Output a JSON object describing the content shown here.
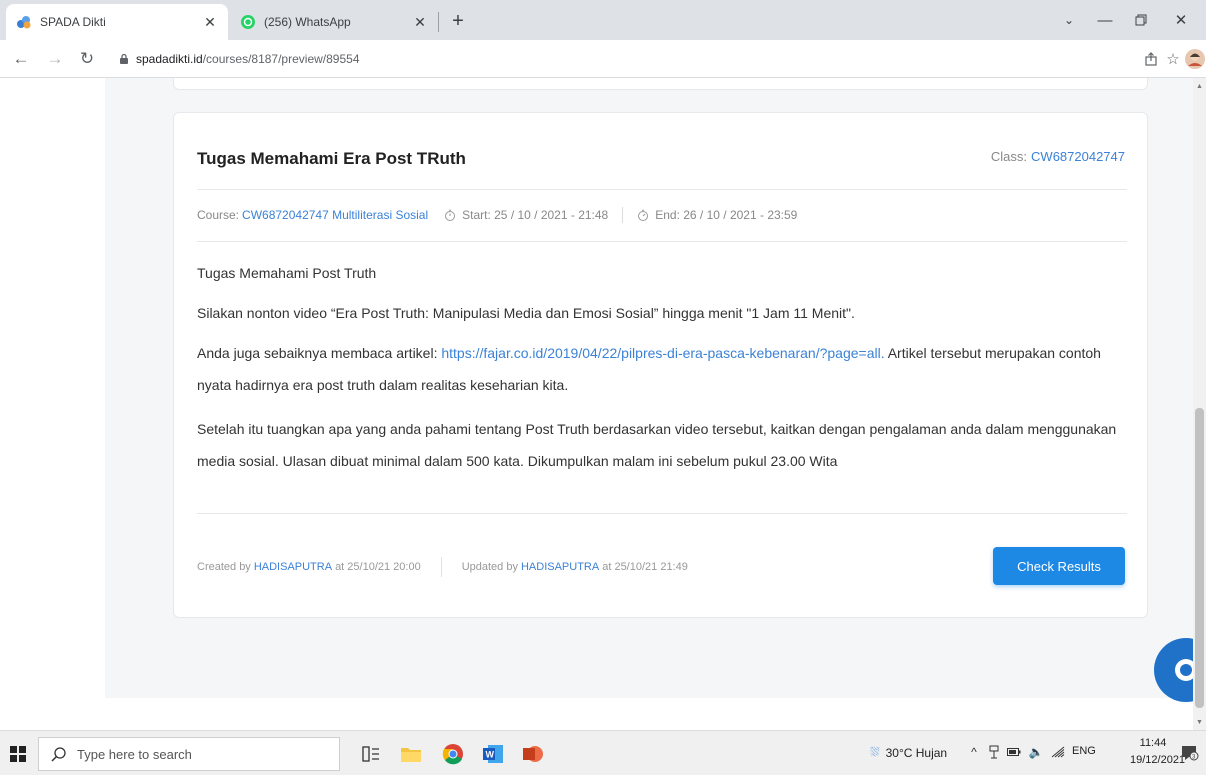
{
  "browser": {
    "tabs": [
      {
        "title": "SPADA Dikti",
        "active": true,
        "icon": "spada-logo-icon"
      },
      {
        "title": "(256) WhatsApp",
        "active": false,
        "icon": "whatsapp-icon"
      }
    ],
    "url_domain": "spadadikti.id",
    "url_path": "/courses/8187/preview/89554"
  },
  "card": {
    "title": "Tugas Memahami Era Post TRuth",
    "class_label": "Class:",
    "class_code": "CW6872042747",
    "course_label": "Course:",
    "course_name": "CW6872042747 Multiliterasi Sosial",
    "start": "Start: 25 / 10 / 2021 - 21:48",
    "end": "End: 26 / 10 / 2021 - 23:59",
    "paragraphs": {
      "p1": "Tugas Memahami Post Truth",
      "p2": "Silakan nonton video “Era Post Truth: Manipulasi Media dan Emosi Sosial” hingga menit \"1 Jam 11 Menit\".",
      "p3_before": "Anda juga sebaiknya membaca artikel: ",
      "p3_link": "https://fajar.co.id/2019/04/22/pilpres-di-era-pasca-kebenaran/?page=all.",
      "p3_after": " Artikel tersebut merupakan contoh nyata hadirnya era post truth dalam realitas keseharian kita.",
      "p4": "Setelah itu tuangkan apa yang anda pahami tentang Post Truth berdasarkan video tersebut, kaitkan dengan pengalaman anda dalam menggunakan media sosial. Ulasan dibuat minimal dalam 500 kata. Dikumpulkan malam ini sebelum pukul 23.00 Wita"
    },
    "created_prefix": "Created by",
    "created_by": "HADISAPUTRA",
    "created_at": "at 25/10/21 20:00",
    "updated_prefix": "Updated by",
    "updated_by": "HADISAPUTRA",
    "updated_at": "at 25/10/21 21:49",
    "button_label": "Check Results"
  },
  "taskbar": {
    "search_placeholder": "Type here to search",
    "weather": "30°C  Hujan",
    "language": "ENG",
    "time": "11:44",
    "date": "19/12/2021"
  },
  "colors": {
    "link": "#3b82d6",
    "button": "#1e88e5",
    "chat": "#1f72c8"
  }
}
